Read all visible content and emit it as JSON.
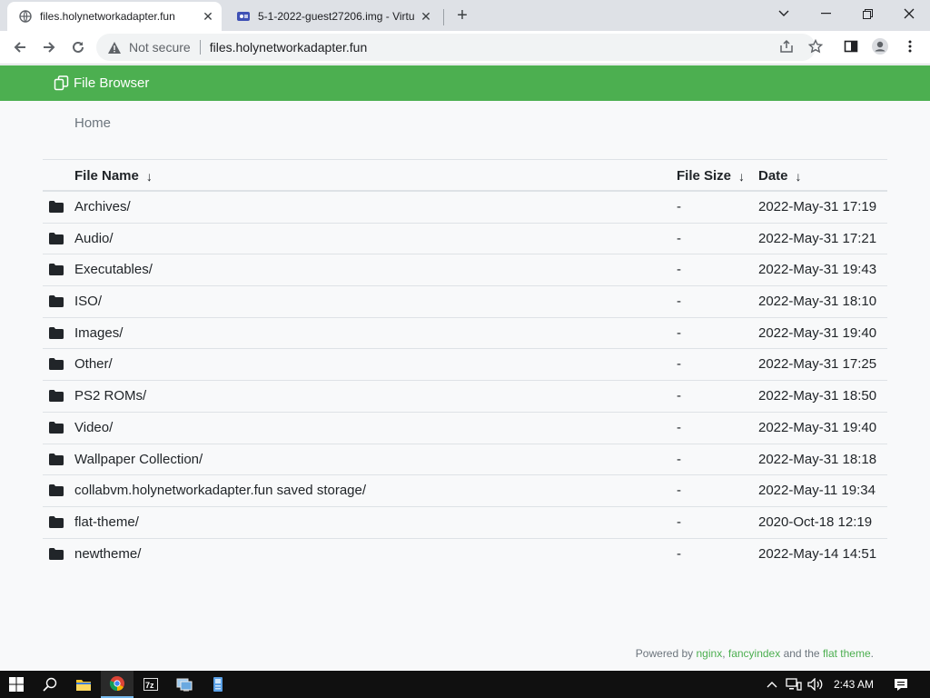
{
  "browser": {
    "tabs": [
      {
        "title": "files.holynetworkadapter.fun",
        "active": true
      },
      {
        "title": "5-1-2022-guest27206.img - Virtu",
        "active": false
      }
    ],
    "omnibox": {
      "security_label": "Not secure",
      "url": "files.holynetworkadapter.fun"
    }
  },
  "header": {
    "brand": "File Browser",
    "color": "#4caf50"
  },
  "breadcrumb": {
    "home": "Home"
  },
  "table": {
    "columns": {
      "name": "File Name",
      "size": "File Size",
      "date": "Date",
      "sort_arrow": "↓"
    },
    "rows": [
      {
        "name": "Archives/",
        "size": "-",
        "date": "2022-May-31 17:19"
      },
      {
        "name": "Audio/",
        "size": "-",
        "date": "2022-May-31 17:21"
      },
      {
        "name": "Executables/",
        "size": "-",
        "date": "2022-May-31 19:43"
      },
      {
        "name": "ISO/",
        "size": "-",
        "date": "2022-May-31 18:10"
      },
      {
        "name": "Images/",
        "size": "-",
        "date": "2022-May-31 19:40"
      },
      {
        "name": "Other/",
        "size": "-",
        "date": "2022-May-31 17:25"
      },
      {
        "name": "PS2 ROMs/",
        "size": "-",
        "date": "2022-May-31 18:50"
      },
      {
        "name": "Video/",
        "size": "-",
        "date": "2022-May-31 19:40"
      },
      {
        "name": "Wallpaper Collection/",
        "size": "-",
        "date": "2022-May-31 18:18"
      },
      {
        "name": "collabvm.holynetworkadapter.fun saved storage/",
        "size": "-",
        "date": "2022-May-11 19:34"
      },
      {
        "name": "flat-theme/",
        "size": "-",
        "date": "2020-Oct-18 12:19"
      },
      {
        "name": "newtheme/",
        "size": "-",
        "date": "2022-May-14 14:51"
      }
    ]
  },
  "footer": {
    "prefix": "Powered by ",
    "link1": "nginx",
    "sep1": ", ",
    "link2": "fancyindex",
    "mid": " and the ",
    "link3": "flat theme",
    "suffix": "."
  },
  "taskbar": {
    "clock": "2:43 AM"
  }
}
